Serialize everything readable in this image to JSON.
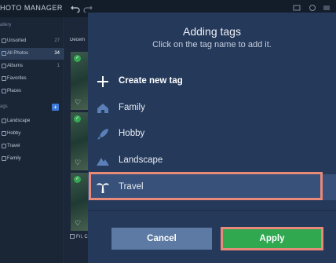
{
  "app": {
    "title": "HOTO MANAGER"
  },
  "sidebar": {
    "gallery_heading": "allery",
    "tags_heading": "ags",
    "add_tag_symbol": "+",
    "gallery_items": [
      {
        "label": "Unsorted",
        "count": "27"
      },
      {
        "label": "All Photos",
        "count": "34"
      },
      {
        "label": "Albums",
        "count": "1"
      },
      {
        "label": "Favorites",
        "count": ""
      },
      {
        "label": "Places",
        "count": ""
      }
    ],
    "tag_items": [
      {
        "label": "Landscape"
      },
      {
        "label": "Hobby"
      },
      {
        "label": "Travel"
      },
      {
        "label": "Family"
      }
    ]
  },
  "content": {
    "date_label": "Decem",
    "footer_label": "Fri, C"
  },
  "dialog": {
    "title": "Adding tags",
    "subtitle": "Click on the tag name to add it.",
    "create_label": "Create new tag",
    "tags": [
      {
        "label": "Family",
        "icon": "house-icon"
      },
      {
        "label": "Hobby",
        "icon": "rocket-icon"
      },
      {
        "label": "Landscape",
        "icon": "mountain-icon"
      },
      {
        "label": "Travel",
        "icon": "palm-tree-icon",
        "selected": true
      }
    ],
    "cancel_label": "Cancel",
    "apply_label": "Apply"
  },
  "colors": {
    "dialog_bg": "#25395a",
    "selected_row": "#37517a",
    "highlight": "#e88a79",
    "apply_green": "#2fa84f",
    "cancel_blue": "#5c7aa3"
  }
}
